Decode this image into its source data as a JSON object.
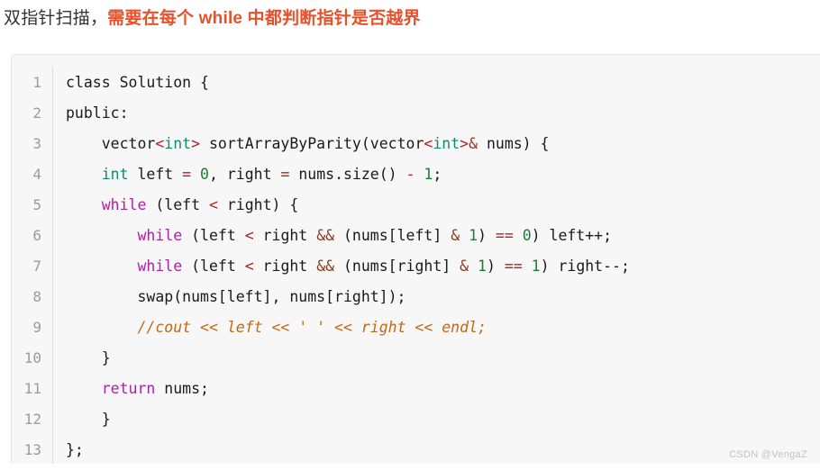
{
  "heading": {
    "plain_text": "双指针扫描，",
    "accent_text": "需要在每个 while 中都判断指针是否越界",
    "accent_color": "#e8512b",
    "plain_color": "#313131"
  },
  "code_block": {
    "language": "cpp",
    "background_color": "#f7f7f8",
    "gutter_color": "#9b9b9b",
    "line_count": 13,
    "line_numbers": [
      "1",
      "2",
      "3",
      "4",
      "5",
      "6",
      "7",
      "8",
      "9",
      "10",
      "11",
      "12",
      "13"
    ],
    "lines": [
      {
        "n": "1",
        "text": "class Solution {"
      },
      {
        "n": "2",
        "text": "public:"
      },
      {
        "n": "3",
        "text": "    vector<int> sortArrayByParity(vector<int>& nums) {"
      },
      {
        "n": "4",
        "text": "    int left = 0, right = nums.size() - 1;"
      },
      {
        "n": "5",
        "text": "    while (left < right) {"
      },
      {
        "n": "6",
        "text": "        while (left < right && (nums[left] & 1) == 0) left++;"
      },
      {
        "n": "7",
        "text": "        while (left < right && (nums[right] & 1) == 1) right--;"
      },
      {
        "n": "8",
        "text": "        swap(nums[left], nums[right]);"
      },
      {
        "n": "9",
        "text": "        //cout << left << ' ' << right << endl;"
      },
      {
        "n": "10",
        "text": "    }"
      },
      {
        "n": "11",
        "text": "    return nums;"
      },
      {
        "n": "12",
        "text": "    }"
      },
      {
        "n": "13",
        "text": "};"
      }
    ],
    "tokens": {
      "l1": [
        {
          "t": "class Solution {",
          "c": "t-plain"
        }
      ],
      "l2": [
        {
          "t": "public:",
          "c": "t-plain"
        }
      ],
      "l3": [
        {
          "t": "    vector",
          "c": "t-plain"
        },
        {
          "t": "<",
          "c": "t-op"
        },
        {
          "t": "int",
          "c": "t-type"
        },
        {
          "t": ">",
          "c": "t-op"
        },
        {
          "t": " sortArrayByParity(vector",
          "c": "t-plain"
        },
        {
          "t": "<",
          "c": "t-op"
        },
        {
          "t": "int",
          "c": "t-type"
        },
        {
          "t": ">",
          "c": "t-op"
        },
        {
          "t": "&",
          "c": "t-amp"
        },
        {
          "t": " nums) {",
          "c": "t-plain"
        }
      ],
      "l4": [
        {
          "t": "    ",
          "c": "t-plain"
        },
        {
          "t": "int",
          "c": "t-type"
        },
        {
          "t": " left ",
          "c": "t-plain"
        },
        {
          "t": "=",
          "c": "t-op"
        },
        {
          "t": " ",
          "c": "t-plain"
        },
        {
          "t": "0",
          "c": "t-num"
        },
        {
          "t": ", right ",
          "c": "t-plain"
        },
        {
          "t": "=",
          "c": "t-op"
        },
        {
          "t": " nums.size() ",
          "c": "t-plain"
        },
        {
          "t": "-",
          "c": "t-op"
        },
        {
          "t": " ",
          "c": "t-plain"
        },
        {
          "t": "1",
          "c": "t-num"
        },
        {
          "t": ";",
          "c": "t-plain"
        }
      ],
      "l5": [
        {
          "t": "    ",
          "c": "t-plain"
        },
        {
          "t": "while",
          "c": "t-kw"
        },
        {
          "t": " (left ",
          "c": "t-plain"
        },
        {
          "t": "<",
          "c": "t-op"
        },
        {
          "t": " right) {",
          "c": "t-plain"
        }
      ],
      "l6": [
        {
          "t": "        ",
          "c": "t-plain"
        },
        {
          "t": "while",
          "c": "t-kw"
        },
        {
          "t": " (left ",
          "c": "t-plain"
        },
        {
          "t": "<",
          "c": "t-op"
        },
        {
          "t": " right ",
          "c": "t-plain"
        },
        {
          "t": "&&",
          "c": "t-amp"
        },
        {
          "t": " (nums[left] ",
          "c": "t-plain"
        },
        {
          "t": "&",
          "c": "t-amp"
        },
        {
          "t": " ",
          "c": "t-plain"
        },
        {
          "t": "1",
          "c": "t-num"
        },
        {
          "t": ") ",
          "c": "t-plain"
        },
        {
          "t": "==",
          "c": "t-op"
        },
        {
          "t": " ",
          "c": "t-plain"
        },
        {
          "t": "0",
          "c": "t-num"
        },
        {
          "t": ") left++;",
          "c": "t-plain"
        }
      ],
      "l7": [
        {
          "t": "        ",
          "c": "t-plain"
        },
        {
          "t": "while",
          "c": "t-kw"
        },
        {
          "t": " (left ",
          "c": "t-plain"
        },
        {
          "t": "<",
          "c": "t-op"
        },
        {
          "t": " right ",
          "c": "t-plain"
        },
        {
          "t": "&&",
          "c": "t-amp"
        },
        {
          "t": " (nums[right] ",
          "c": "t-plain"
        },
        {
          "t": "&",
          "c": "t-amp"
        },
        {
          "t": " ",
          "c": "t-plain"
        },
        {
          "t": "1",
          "c": "t-num"
        },
        {
          "t": ") ",
          "c": "t-plain"
        },
        {
          "t": "==",
          "c": "t-op"
        },
        {
          "t": " ",
          "c": "t-plain"
        },
        {
          "t": "1",
          "c": "t-num"
        },
        {
          "t": ") right--;",
          "c": "t-plain"
        }
      ],
      "l8": [
        {
          "t": "        swap(nums[left], nums[right]);",
          "c": "t-plain"
        }
      ],
      "l9": [
        {
          "t": "        ",
          "c": "t-plain"
        },
        {
          "t": "//cout << left << ' ' << right << endl;",
          "c": "t-comment"
        }
      ],
      "l10": [
        {
          "t": "    }",
          "c": "t-plain"
        }
      ],
      "l11": [
        {
          "t": "    ",
          "c": "t-plain"
        },
        {
          "t": "return",
          "c": "t-kw"
        },
        {
          "t": " nums;",
          "c": "t-plain"
        }
      ],
      "l12": [
        {
          "t": "    }",
          "c": "t-plain"
        }
      ],
      "l13": [
        {
          "t": "};",
          "c": "t-plain"
        }
      ]
    }
  },
  "watermark": {
    "text": "CSDN @VengaZ"
  }
}
